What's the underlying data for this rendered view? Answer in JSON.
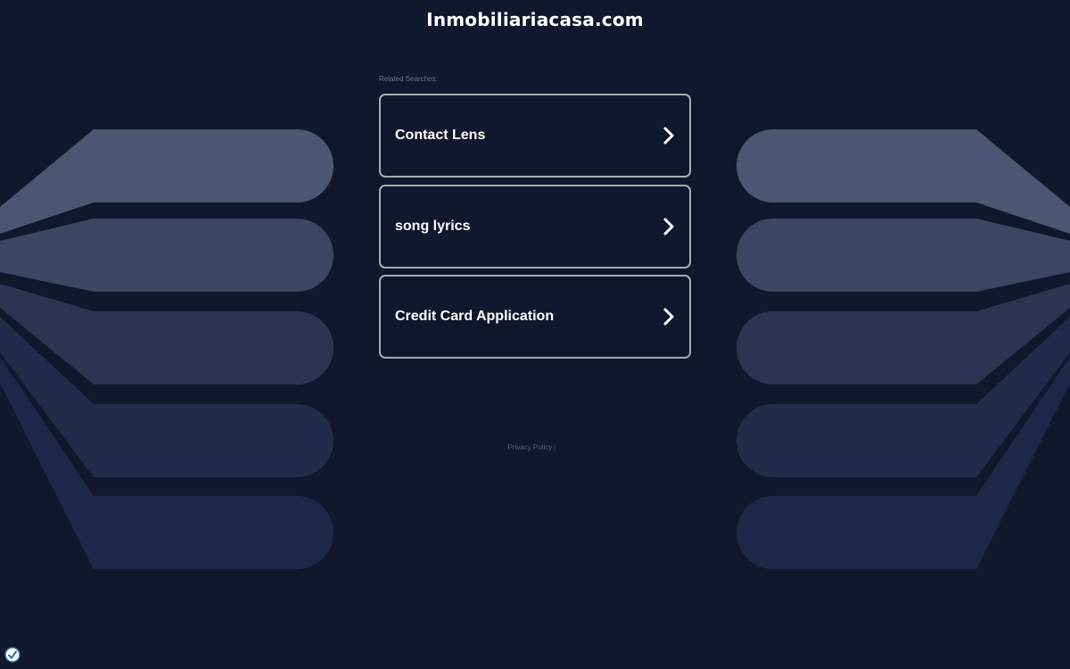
{
  "header": {
    "domain": "Inmobiliariacasa.com"
  },
  "related": {
    "label": "Related Searches:",
    "items": [
      {
        "label": "Contact Lens"
      },
      {
        "label": "song lyrics"
      },
      {
        "label": "Credit Card Application"
      }
    ]
  },
  "footer": {
    "privacy_label": "Privacy Policy",
    "separator": "|"
  },
  "icons": {
    "chevron": "chevron-right-icon",
    "badge": "privacy-shield-icon"
  },
  "colors": {
    "background": "#11172c",
    "card_border": "#a9abb3",
    "band_1": "#4c5672",
    "band_2": "#3c4562",
    "band_3": "#2c3452",
    "band_4": "#222b4a",
    "band_5": "#1e2748"
  }
}
